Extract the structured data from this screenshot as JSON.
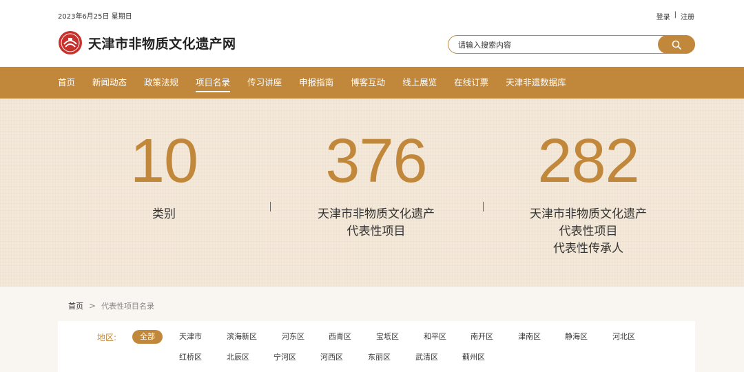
{
  "header": {
    "date": "2023年6月25日 星期日",
    "login": "登录",
    "separator": "|",
    "register": "注册",
    "site_name": "天津市非物质文化遗产网",
    "search_placeholder": "请输入搜索内容"
  },
  "nav": {
    "items": [
      "首页",
      "新闻动态",
      "政策法规",
      "项目名录",
      "传习讲座",
      "申报指南",
      "博客互动",
      "线上展览",
      "在线订票",
      "天津非遗数据库"
    ],
    "active": "项目名录"
  },
  "stats": [
    {
      "value": "10",
      "label": [
        "类别"
      ]
    },
    {
      "value": "376",
      "label": [
        "天津市非物质文化遗产",
        "代表性项目"
      ]
    },
    {
      "value": "282",
      "label": [
        "天津市非物质文化遗产",
        "代表性项目",
        "代表性传承人"
      ]
    }
  ],
  "breadcrumb": {
    "home": "首页",
    "sep": ">",
    "current": "代表性项目名录"
  },
  "filter": {
    "label": "地区:",
    "row1": [
      "全部",
      "天津市",
      "滨海新区",
      "河东区",
      "西青区",
      "宝坻区",
      "和平区",
      "南开区",
      "津南区",
      "静海区",
      "河北区"
    ],
    "row2": [
      "红桥区",
      "北辰区",
      "宁河区",
      "河西区",
      "东丽区",
      "武清区",
      "蓟州区"
    ],
    "active": "全部"
  },
  "colors": {
    "accent": "#c1883b",
    "hero_bg": "#f3e8d9"
  },
  "icons": {
    "search": "search-icon",
    "logo": "logo-emblem-icon",
    "breadcrumb_sep": "chevron-right-icon"
  }
}
